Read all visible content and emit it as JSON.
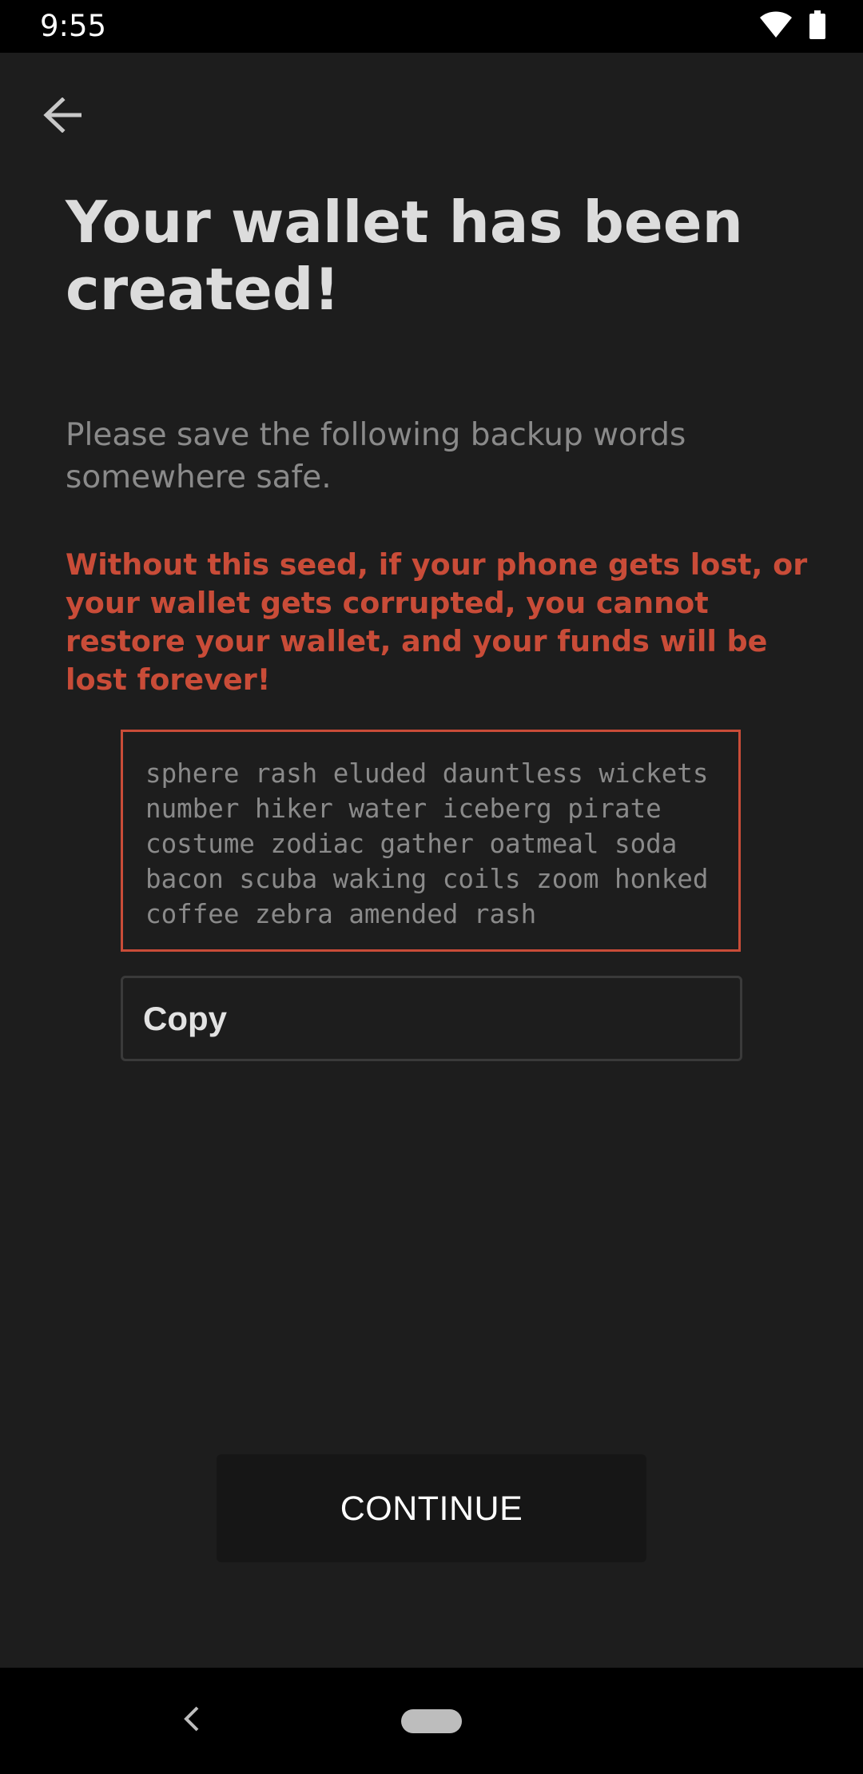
{
  "status_bar": {
    "time": "9:55",
    "icons": [
      "wifi-icon",
      "battery-icon"
    ]
  },
  "header": {
    "back_icon": "arrow-left-icon"
  },
  "main": {
    "title": "Your wallet has been created!",
    "subtitle": "Please save the following backup words somewhere safe.",
    "warning": "Without this seed, if your phone gets lost, or your wallet gets corrupted, you cannot restore your wallet, and your funds will be lost forever!",
    "seed_words": "sphere rash eluded dauntless wickets number hiker water iceberg pirate costume zodiac gather oatmeal soda bacon scuba waking coils zoom honked coffee zebra amended rash",
    "copy_label": "Copy",
    "continue_label": "CONTINUE"
  },
  "nav_bar": {
    "back_icon": "chevron-left-icon",
    "home_icon": "home-pill-icon"
  },
  "colors": {
    "background": "#1d1d1d",
    "title": "#dcdcdc",
    "subtitle": "#8a8a8a",
    "warning": "#c94c38",
    "seed_border": "#c94c38",
    "button_background": "#161616"
  }
}
